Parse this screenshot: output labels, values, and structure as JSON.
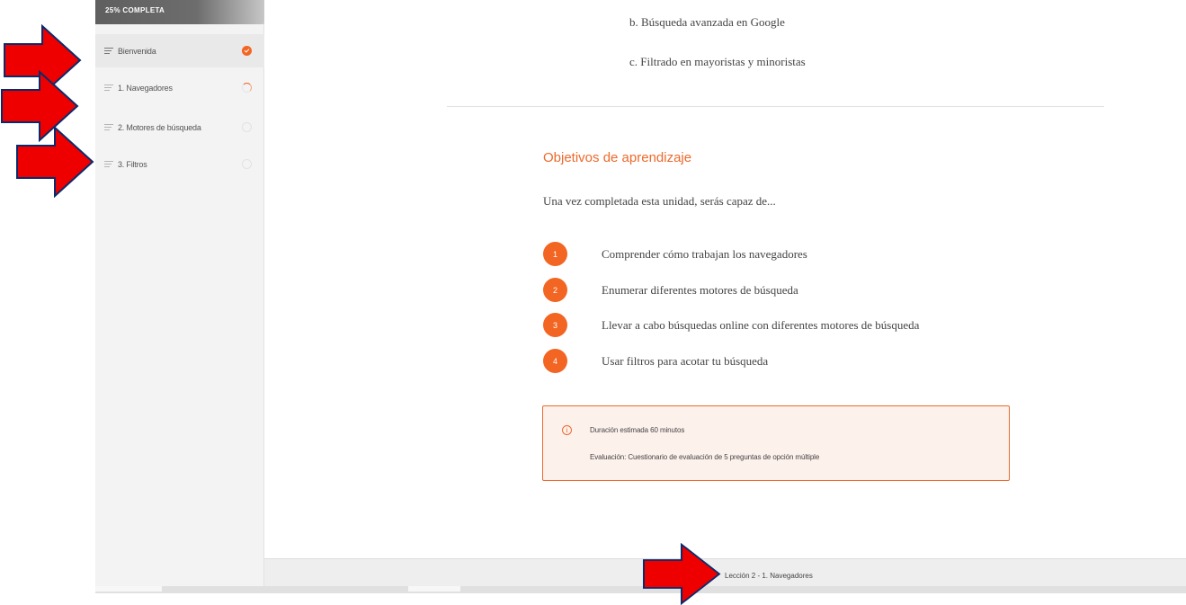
{
  "sidebar": {
    "progress_label": "25% COMPLETA",
    "items": [
      {
        "label": "Bienvenida",
        "status": "completed"
      },
      {
        "label": "1. Navegadores",
        "status": "in-progress"
      },
      {
        "label": "2. Motores de búsqueda",
        "status": "not-started"
      },
      {
        "label": "3. Filtros",
        "status": "not-started"
      }
    ]
  },
  "content": {
    "list_items": [
      "b. Búsqueda avanzada en Google",
      "c. Filtrado en mayoristas y minoristas"
    ],
    "section_title": "Objetivos de aprendizaje",
    "intro": "Una vez completada esta unidad, serás capaz de...",
    "objectives": [
      {
        "number": "1",
        "text": "Comprender cómo trabajan los navegadores"
      },
      {
        "number": "2",
        "text": "Enumerar diferentes motores de búsqueda"
      },
      {
        "number": "3",
        "text": "Llevar a cabo búsquedas online con diferentes motores de búsqueda"
      },
      {
        "number": "4",
        "text": "Usar filtros para acotar tu búsqueda"
      }
    ],
    "info_box": {
      "icon": "info-icon",
      "icon_glyph": "i",
      "duration": "Duración estimada 60 minutos",
      "evaluation": "Evaluación: Cuestionario de evaluación de 5 preguntas de opción múltiple"
    }
  },
  "footer": {
    "lesson_label": "Lección 2 - 1. Navegadores"
  },
  "colors": {
    "accent": "#f26522",
    "arrow": "#ee0000"
  }
}
